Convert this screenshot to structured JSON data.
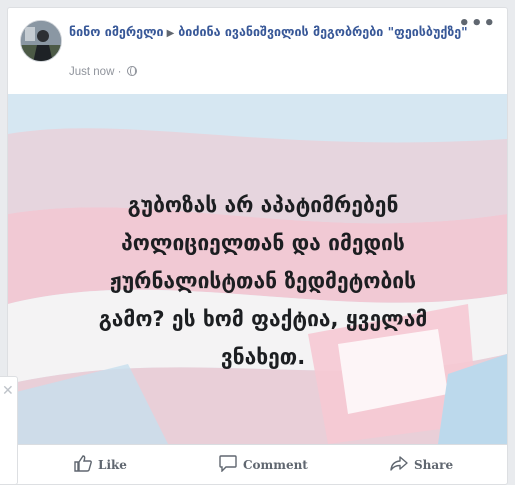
{
  "post": {
    "author": "ნინო იმერელი",
    "group": "ბიძინა ივანიშვილის მეგობრები \"ფეისბუქზე\"",
    "timestamp": "Just now",
    "text_lines": [
      "გუბოზას არ აპატიმრებენ",
      "პოლიციელთან და იმედის",
      "ჟურნალისტთან ზედმეტობის",
      "გამო? ეს ხომ ფაქტია, ყველამ",
      "ვნახეთ."
    ]
  },
  "actions": {
    "like": "Like",
    "comment": "Comment",
    "share": "Share"
  },
  "icons": {
    "more": "more-horizontal-icon",
    "privacy": "globe-icon",
    "like": "thumbs-up-icon",
    "comment": "speech-bubble-icon",
    "share": "share-arrow-icon",
    "close": "close-icon"
  },
  "colors": {
    "author_link": "#385898",
    "flag_pink": "#f1c9d4",
    "flag_blue": "#bcd9ec"
  }
}
